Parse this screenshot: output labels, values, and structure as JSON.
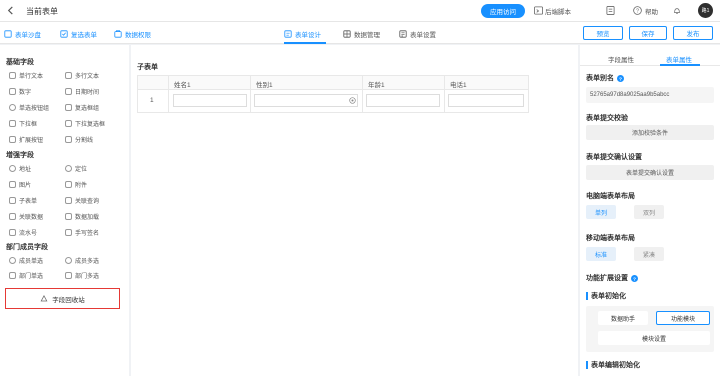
{
  "header": {
    "title": "当前表单",
    "publish_label": "应用访问",
    "script_label": "后端脚本",
    "help_label": "帮助",
    "avatar_text": "路1"
  },
  "toolbar": {
    "left_items": [
      "表单沙盘",
      "复选表单",
      "数据权限"
    ],
    "tabs": [
      "表单设计",
      "数据管理",
      "表单设置"
    ],
    "active_tab": 0,
    "preview_label": "预览",
    "save_label": "保存",
    "publish_label": "发布"
  },
  "left_panel": {
    "groups": [
      {
        "title": "基础字段",
        "items": [
          "单行文本",
          "多行文本",
          "数字",
          "日期时间",
          "单选按钮组",
          "复选框组",
          "下拉框",
          "下拉复选框",
          "扩展按钮",
          "分割线"
        ]
      },
      {
        "title": "增强字段",
        "items": [
          "地址",
          "定位",
          "图片",
          "附件",
          "子表单",
          "关联查询",
          "关联数据",
          "数据加载",
          "流水号",
          "手写签名"
        ]
      },
      {
        "title": "部门成员字段",
        "items": [
          "成员单选",
          "成员多选",
          "部门单选",
          "部门多选"
        ]
      }
    ],
    "recycle_label": "字段回收站"
  },
  "canvas": {
    "subform_title": "子表单",
    "columns": [
      "姓名1",
      "性别1",
      "年龄1",
      "电话1"
    ],
    "row_number": "1"
  },
  "right_panel": {
    "tabs": [
      "字段属性",
      "表单属性"
    ],
    "active_tab": 1,
    "alias_label": "表单别名",
    "alias_value": "52765a97d8a9025aa9b5abcc",
    "submit_check_label": "表单提交校验",
    "add_check_button": "添加校验条件",
    "submit_confirm_label": "表单提交确认设置",
    "submit_confirm_button": "表单提交确认设置",
    "pc_layout_label": "电脑端表单布局",
    "pc_layout_options": [
      "单列",
      "双列"
    ],
    "mobile_layout_label": "移动端表单布局",
    "mobile_layout_options": [
      "标准",
      "紧凑"
    ],
    "ext_label": "功能扩展设置",
    "init_label": "表单初始化",
    "init_options": [
      "数据助手",
      "功能模块"
    ],
    "module_button": "模块设置",
    "edit_init_label": "表单编辑初始化"
  },
  "colors": {
    "accent": "#1890ff",
    "highlight_border": "#e53935"
  }
}
